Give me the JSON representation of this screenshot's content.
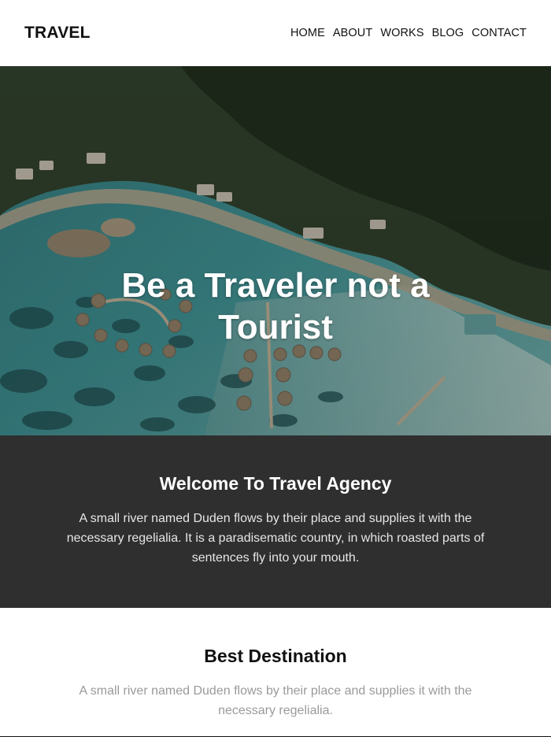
{
  "header": {
    "logo": "TRAVEL",
    "nav": [
      "HOME",
      "ABOUT",
      "WORKS",
      "BLOG",
      "CONTACT"
    ]
  },
  "hero": {
    "title": "Be a Traveler not a Tourist"
  },
  "welcome": {
    "title": "Welcome To Travel Agency",
    "text": "A small river named Duden flows by their place and supplies it with the necessary regelialia. It is a paradisematic country, in which roasted parts of sentences fly into your mouth."
  },
  "destination": {
    "title": "Best Destination",
    "text": "A small river named Duden flows by their place and supplies it with the necessary regelialia."
  }
}
